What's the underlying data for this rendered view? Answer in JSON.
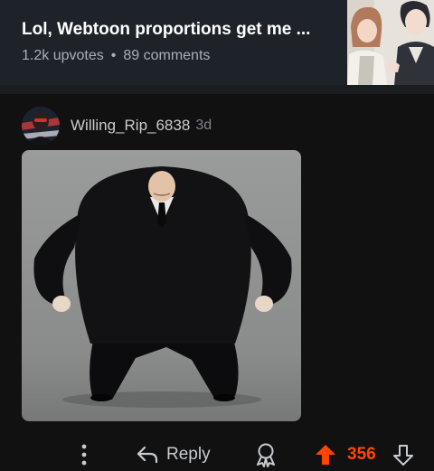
{
  "post": {
    "title": "Lol, Webtoon proportions get me ...",
    "upvotes": "1.2k upvotes",
    "separator": "•",
    "comments": "89 comments"
  },
  "comment": {
    "username": "Willing_Rip_6838",
    "age": "3d",
    "actions": {
      "reply_label": "Reply",
      "score": "356"
    }
  },
  "colors": {
    "background": "#111111",
    "header_bg": "#1e2329",
    "upvote_accent": "#ff4500"
  },
  "icons": [
    "more-options-icon",
    "reply-arrow-icon",
    "award-icon",
    "upvote-arrow-icon",
    "downvote-arrow-icon"
  ]
}
